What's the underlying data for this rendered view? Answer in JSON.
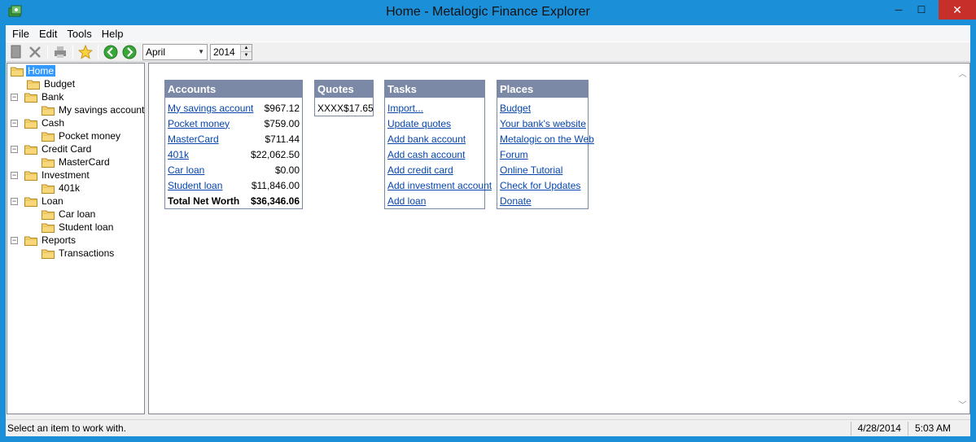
{
  "window": {
    "title": "Home - Metalogic Finance Explorer",
    "min_glyph": "─",
    "max_glyph": "☐",
    "close_glyph": "✕"
  },
  "menu": [
    "File",
    "Edit",
    "Tools",
    "Help"
  ],
  "toolbar": {
    "icons": [
      "new-icon",
      "delete-icon",
      "print-icon",
      "favorite-star-icon",
      "back-icon",
      "forward-icon"
    ],
    "month": "April",
    "year": "2014"
  },
  "tree": [
    {
      "label": "Home",
      "depth": 0,
      "expander": "",
      "selected": true
    },
    {
      "label": "Budget",
      "depth": 1,
      "expander": "",
      "selected": false
    },
    {
      "label": "Bank",
      "depth": 0,
      "expander": "−",
      "selected": false
    },
    {
      "label": "My savings account",
      "depth": 2,
      "expander": "",
      "selected": false
    },
    {
      "label": "Cash",
      "depth": 0,
      "expander": "−",
      "selected": false
    },
    {
      "label": "Pocket money",
      "depth": 2,
      "expander": "",
      "selected": false
    },
    {
      "label": "Credit Card",
      "depth": 0,
      "expander": "−",
      "selected": false
    },
    {
      "label": "MasterCard",
      "depth": 2,
      "expander": "",
      "selected": false
    },
    {
      "label": "Investment",
      "depth": 0,
      "expander": "−",
      "selected": false
    },
    {
      "label": "401k",
      "depth": 2,
      "expander": "",
      "selected": false
    },
    {
      "label": "Loan",
      "depth": 0,
      "expander": "−",
      "selected": false
    },
    {
      "label": "Car loan",
      "depth": 2,
      "expander": "",
      "selected": false
    },
    {
      "label": "Student loan",
      "depth": 2,
      "expander": "",
      "selected": false
    },
    {
      "label": "Reports",
      "depth": 0,
      "expander": "−",
      "selected": false
    },
    {
      "label": "Transactions",
      "depth": 2,
      "expander": "",
      "selected": false
    }
  ],
  "accounts": {
    "title": "Accounts",
    "rows": [
      {
        "name": "My savings account",
        "amount": "$967.12"
      },
      {
        "name": "Pocket money",
        "amount": "$759.00"
      },
      {
        "name": "MasterCard",
        "amount": "$711.44"
      },
      {
        "name": "401k",
        "amount": "$22,062.50"
      },
      {
        "name": "Car loan",
        "amount": "$0.00"
      },
      {
        "name": "Student loan",
        "amount": "$11,846.00"
      }
    ],
    "total_label": "Total Net Worth",
    "total_value": "$36,346.06"
  },
  "quotes": {
    "title": "Quotes",
    "rows": [
      {
        "symbol": "XXXX",
        "price": "$17.65"
      }
    ]
  },
  "tasks": {
    "title": "Tasks",
    "items": [
      "Import...",
      "Update quotes",
      "Add bank account",
      "Add cash account",
      "Add credit card",
      "Add investment account",
      "Add loan"
    ]
  },
  "places": {
    "title": "Places",
    "items": [
      "Budget",
      "Your bank's website",
      "Metalogic on the Web",
      "Forum",
      "Online Tutorial",
      "Check for Updates",
      "Donate"
    ]
  },
  "status": {
    "message": "Select an item to work with.",
    "date": "4/28/2014",
    "time": "5:03 AM"
  },
  "colors": {
    "titlebar": "#1b8fd8",
    "panel_header": "#7b89a6",
    "link": "#0645ad",
    "selection": "#3399ff",
    "close_button": "#c7302a"
  }
}
